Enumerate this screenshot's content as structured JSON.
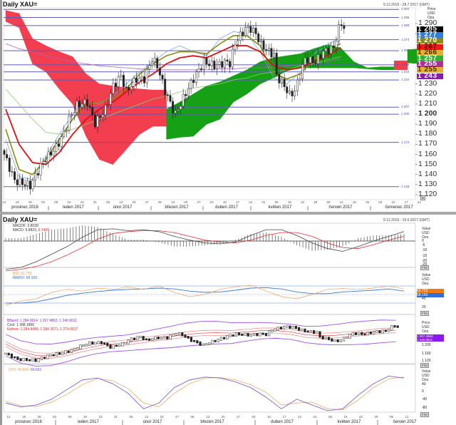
{
  "top_window": {
    "title": "Daily XAU=",
    "date_range": "9.12.2016 - 28.7.2017 (GMT)",
    "axis_unit": [
      "Price",
      "USD",
      "Oza"
    ],
    "axis_button": "B",
    "level_labels": [
      "1 304",
      "1 296",
      "1 288",
      "1 274",
      "1 263",
      "1 249",
      "1 242",
      "1 234",
      "1 207",
      "1 200",
      "1 172",
      "1 128"
    ],
    "levels": [
      1304,
      1296,
      1288,
      1274,
      1263,
      1249,
      1242,
      1234,
      1207,
      1200,
      1172,
      1128
    ],
    "price_ticks": [
      "1 290",
      "1 280",
      "1 230",
      "1 220",
      "1 210",
      "1 200",
      "1 190",
      "1 180",
      "1 170",
      "1 160",
      "1 150",
      "1 140",
      "1 130",
      "1 120"
    ],
    "price_tick_values": [
      1290,
      1280,
      1230,
      1220,
      1210,
      1200,
      1190,
      1180,
      1170,
      1160,
      1150,
      1140,
      1130,
      1120
    ],
    "price_boxes": [
      {
        "text": "1 285",
        "bg": "#000000",
        "fg": "#ffffff"
      },
      {
        "text": "1 277",
        "bg": "#2f7de0",
        "fg": "#ffffff"
      },
      {
        "text": "1 270",
        "bg": "#8c8a14",
        "fg": "#ffffff"
      },
      {
        "text": "1 267",
        "bg": "#ee1a1a",
        "fg": "#5a0000"
      },
      {
        "text": "1 266",
        "bg": "#e8b030",
        "fg": "#4a3000"
      },
      {
        "text": "1 257",
        "bg": "#34b030",
        "fg": "#ffffff"
      },
      {
        "text": "1 255",
        "bg": "#b0309a",
        "fg": "#ffffff"
      },
      {
        "text": "1 255",
        "bg": "#e8b030",
        "fg": "#4a3000"
      },
      {
        "text": "1 243",
        "bg": "#8a1aa8",
        "fg": "#ffffff"
      }
    ],
    "date_ticks": [
      "12",
      "19",
      "26",
      "03",
      "09",
      "16",
      "23",
      "31",
      "06",
      "13",
      "20",
      "27",
      "06",
      "13",
      "20",
      "27",
      "03",
      "10",
      "17",
      "24",
      "01",
      "08",
      "15",
      "22",
      "29",
      "05",
      "12",
      "19",
      "26",
      "03",
      "10",
      "17",
      "24"
    ],
    "months": [
      "prosinec 2016",
      "leden 2017",
      "únor 2017",
      "březen 2017",
      "duben 2017",
      "květen 2017",
      "červen 2017",
      "červenec 2017"
    ]
  },
  "bottom_window": {
    "title": "Daily XAU=",
    "date_range": "9.12.2016 - 16.6.2017 (GMT)",
    "macd": {
      "label1": "MACDF: 3.8038",
      "label2": "MACD: 9.8823,",
      "label2b": "6.1499",
      "unit": [
        "Value",
        "USD",
        "Oza"
      ],
      "ticks": [
        "0",
        "-5",
        "-10",
        "-15",
        "-20",
        "-25"
      ],
      "button": "F/M"
    },
    "rsi": {
      "label1": "RSI: 62.733",
      "label2": "MARSI: 58.169",
      "unit": [
        "Value",
        "USD",
        "Oza"
      ],
      "box1": "62.733",
      "box2": "58.169",
      "ticks": [
        "40",
        "20"
      ],
      "button": "F/M"
    },
    "bbands": {
      "label1": "BBand: 1 284.0614; 1 267.4863; 1 240.8611",
      "label2": "Cnst: 1 288.1800",
      "label3": "Keltner: 1 284.8486; 1 284.3071; 1 274.0637",
      "unit": [
        "Price",
        "USD",
        "Oza"
      ],
      "box1": "1 267.4863",
      "box2": "1 240.8611",
      "ticks": [
        "1 200",
        "1 160",
        "1 120"
      ],
      "button": "F/M"
    },
    "stoch": {
      "label1": "STO: 66.843,",
      "label2": "66.631",
      "unit": [
        "Value",
        "USD",
        "Oza"
      ],
      "ticks": [
        "40",
        "0",
        "-40",
        "-80"
      ],
      "button": "F/M"
    },
    "date_ticks": [
      "12",
      "19",
      "28",
      "03",
      "09",
      "16",
      "23",
      "31",
      "06",
      "13",
      "20",
      "27",
      "06",
      "13",
      "20",
      "27",
      "03",
      "10",
      "17",
      "24",
      "01",
      "08",
      "15",
      "22",
      "29",
      "05",
      "12"
    ],
    "months": [
      "prosinec 2016",
      "leden 2017",
      "únor 2017",
      "březen 2017",
      "duben 2017",
      "květen 2017",
      "červen 2017"
    ]
  },
  "chart_data": [
    {
      "type": "candlestick",
      "title": "Daily XAU=",
      "ylabel": "Price USD",
      "ylim": [
        1115,
        1310
      ],
      "close_keypoints": {
        "trading_day": [
          0,
          4,
          10,
          15,
          20,
          23,
          25,
          28,
          32,
          35,
          39,
          42,
          45,
          47,
          51,
          54,
          57,
          59,
          62,
          65,
          66,
          70,
          74,
          77,
          81,
          86,
          87,
          89,
          93,
          95,
          97,
          99,
          102,
          104,
          105,
          108,
          110,
          112,
          116,
          120,
          123,
          127,
          129,
          130,
          131
        ],
        "close": [
          1160,
          1134,
          1129,
          1153,
          1167,
          1181,
          1195,
          1209,
          1212,
          1191,
          1205,
          1228,
          1238,
          1223,
          1235,
          1235,
          1255,
          1248,
          1223,
          1205,
          1200,
          1221,
          1240,
          1252,
          1248,
          1252,
          1250,
          1271,
          1285,
          1285,
          1280,
          1269,
          1262,
          1259,
          1238,
          1228,
          1219,
          1223,
          1255,
          1252,
          1262,
          1266,
          1285,
          1290,
          1285
        ]
      },
      "moving_averages_weekly": {
        "red": [
          1205,
          1170,
          1152,
          1150,
          1162,
          1180,
          1195,
          1205,
          1212,
          1222,
          1232,
          1240,
          1250,
          1256,
          1258,
          1256,
          1262,
          1268,
          1268,
          1262,
          1248,
          1244,
          1246,
          1252,
          1258,
          1266
        ],
        "olive": [
          1185,
          1145,
          1140,
          1155,
          1175,
          1195,
          1210,
          1212,
          1215,
          1225,
          1240,
          1250,
          1258,
          1262,
          1262,
          1260,
          1270,
          1278,
          1278,
          1268,
          1240,
          1235,
          1240,
          1255,
          1262,
          1270
        ],
        "blue": [
          1175,
          1138,
          1135,
          1158,
          1180,
          1200,
          1212,
          1210,
          1218,
          1230,
          1242,
          1252,
          1262,
          1268,
          1262,
          1258,
          1275,
          1282,
          1280,
          1262,
          1236,
          1230,
          1242,
          1260,
          1268,
          1277
        ],
        "green": [
          1225,
          1210,
          1195,
          1182,
          1180,
          1185,
          1190,
          1195,
          1200,
          1205,
          1210,
          1215,
          1218,
          1222,
          1226,
          1228,
          1230,
          1234,
          1236,
          1240,
          1242,
          1244,
          1248,
          1250,
          1254,
          1257
        ],
        "purple": [
          1270,
          1265,
          1262,
          1258,
          1255,
          1252,
          1250,
          1248,
          1247,
          1246,
          1245,
          1244,
          1244,
          1244,
          1244,
          1244,
          1245,
          1245,
          1246,
          1246,
          1247,
          1248,
          1249,
          1250,
          1252,
          1255
        ]
      },
      "ichimoku_cloud_weekly": {
        "span_a": [
          1292,
          1286,
          1250,
          1242,
          1225,
          1210,
          1178,
          1155,
          1150,
          1165,
          1180,
          1188,
          1205,
          1212,
          1220,
          1228,
          1232,
          1238,
          1244,
          1252,
          1256,
          1258,
          1260,
          1265,
          1269,
          1266,
          1252,
          1246,
          1247,
          1244,
          1264,
          1265
        ],
        "span_b": [
          1303,
          1300,
          1275,
          1268,
          1262,
          1257,
          1240,
          1230,
          1228,
          1226,
          1225,
          1224,
          1175,
          1177,
          1178,
          1190,
          1195,
          1212,
          1220,
          1230,
          1236,
          1243,
          1246,
          1246,
          1246,
          1246,
          1246,
          1245,
          1244,
          1253,
          1251,
          1250
        ]
      }
    },
    {
      "type": "line",
      "title": "MACD",
      "macd": [
        -30,
        -28,
        -22,
        -14,
        -6,
        4,
        12,
        13,
        11,
        12,
        10,
        5,
        1,
        -2,
        -3,
        -1,
        6,
        12,
        12,
        6,
        -2,
        -8,
        -11,
        -6,
        0,
        5,
        10
      ],
      "signal": [
        -32,
        -30,
        -27,
        -22,
        -15,
        -7,
        2,
        8,
        10,
        11,
        11,
        9,
        5,
        1,
        -1,
        -2,
        1,
        6,
        9,
        9,
        5,
        -2,
        -7,
        -8,
        -4,
        1,
        5
      ]
    },
    {
      "type": "line",
      "title": "RSI",
      "rsi": [
        25,
        35,
        40,
        55,
        62,
        58,
        65,
        62,
        68,
        62,
        70,
        55,
        45,
        50,
        62,
        68,
        72,
        58,
        45,
        40,
        50,
        62,
        64,
        62,
        65,
        70,
        63
      ],
      "marsi": [
        30,
        30,
        33,
        40,
        48,
        53,
        57,
        60,
        62,
        63,
        65,
        63,
        58,
        55,
        56,
        60,
        65,
        66,
        63,
        56,
        52,
        52,
        56,
        58,
        60,
        63,
        58
      ],
      "levels": [
        70,
        50,
        30
      ]
    },
    {
      "type": "line",
      "title": "Stochastic",
      "k": [
        -60,
        -80,
        -70,
        -40,
        10,
        60,
        70,
        40,
        -10,
        -90,
        -60,
        20,
        60,
        75,
        70,
        50,
        20,
        -30,
        -90,
        -40,
        -70,
        -100,
        -90,
        -20,
        40,
        80,
        70
      ],
      "d": [
        -50,
        -75,
        -78,
        -55,
        -15,
        35,
        68,
        55,
        15,
        -60,
        -80,
        -10,
        40,
        70,
        72,
        60,
        35,
        -5,
        -70,
        -60,
        -55,
        -90,
        -95,
        -45,
        20,
        65,
        75
      ]
    }
  ]
}
